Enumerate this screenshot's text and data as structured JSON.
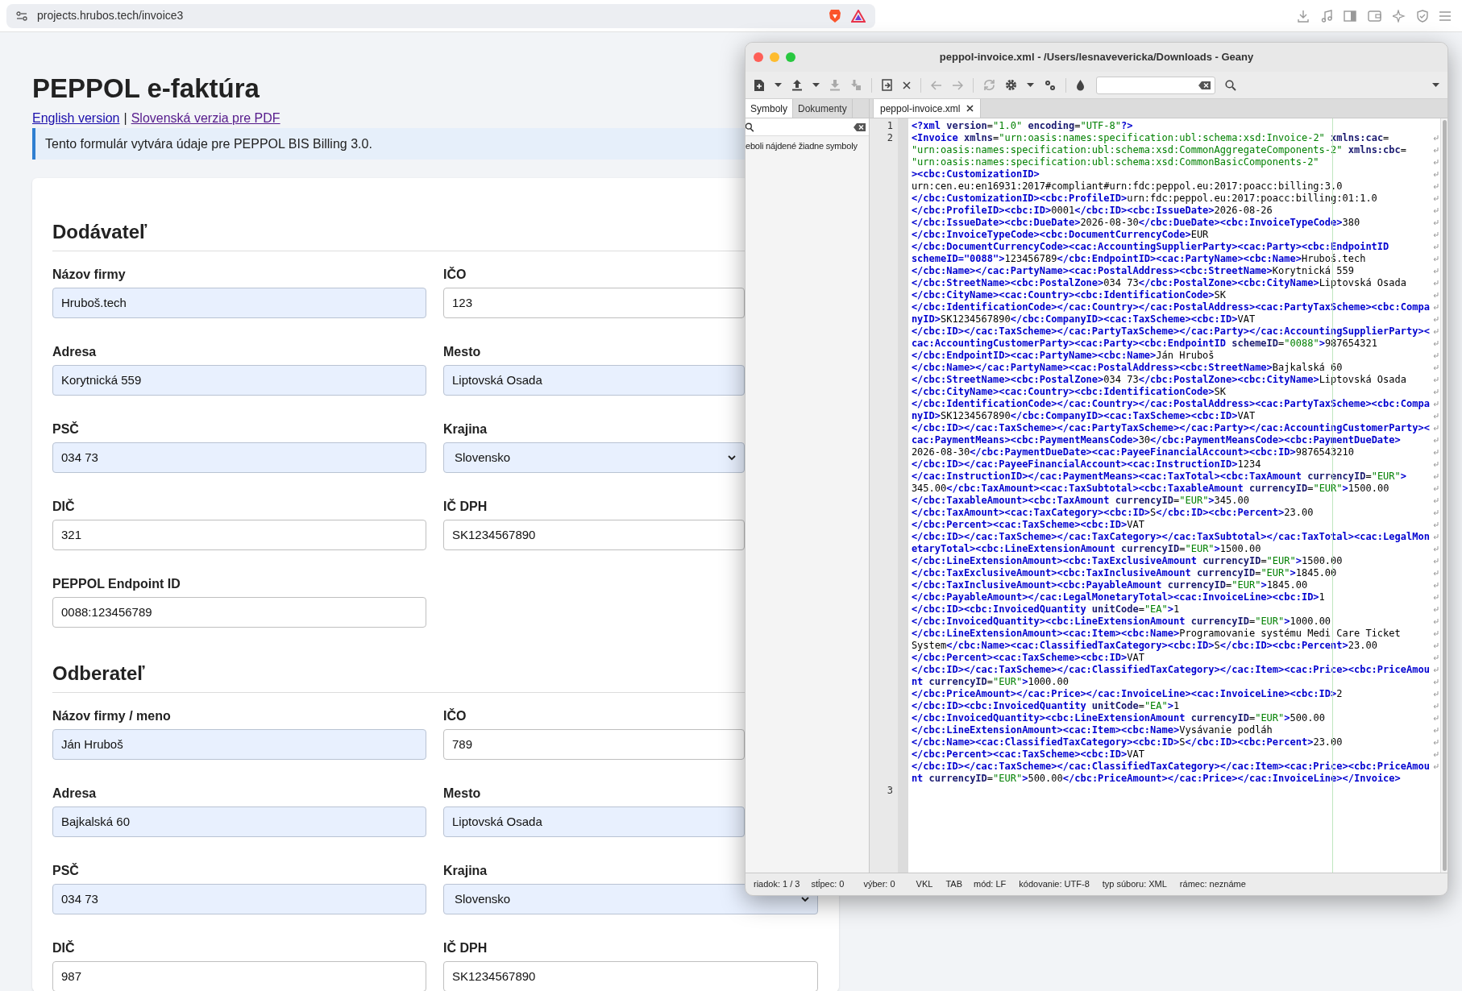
{
  "browser": {
    "url": "projects.hrubos.tech/invoice3"
  },
  "page": {
    "title": "PEPPOL e-faktúra",
    "links": [
      "English version",
      "Slovenská verzia pre PDF"
    ],
    "separator": "|",
    "info": "Tento formulár vytvára údaje pre PEPPOL BIS Billing 3.0.",
    "sections": [
      {
        "heading": "Dodávateľ",
        "fields": [
          {
            "label": "Názov firmy",
            "value": "Hruboš.tech",
            "kind": "input",
            "autofilled": true
          },
          {
            "label": "IČO",
            "value": "123",
            "kind": "input",
            "autofilled": false
          },
          {
            "label": "Adresa",
            "value": "Korytnická 559",
            "kind": "input",
            "autofilled": true
          },
          {
            "label": "Mesto",
            "value": "Liptovská Osada",
            "kind": "input",
            "autofilled": true
          },
          {
            "label": "PSČ",
            "value": "034 73",
            "kind": "input",
            "autofilled": true
          },
          {
            "label": "Krajina",
            "value": "Slovensko",
            "kind": "select",
            "autofilled": true
          },
          {
            "label": "DIČ",
            "value": "321",
            "kind": "input",
            "autofilled": false
          },
          {
            "label": "IČ DPH",
            "value": "SK1234567890",
            "kind": "input",
            "autofilled": false
          },
          {
            "label": "PEPPOL Endpoint ID",
            "value": "0088:123456789",
            "kind": "input",
            "autofilled": false
          }
        ]
      },
      {
        "heading": "Odberateľ",
        "fields": [
          {
            "label": "Názov firmy / meno",
            "value": "Ján Hruboš",
            "kind": "input",
            "autofilled": true
          },
          {
            "label": "IČO",
            "value": "789",
            "kind": "input",
            "autofilled": false
          },
          {
            "label": "Adresa",
            "value": "Bajkalská 60",
            "kind": "input",
            "autofilled": true
          },
          {
            "label": "Mesto",
            "value": "Liptovská Osada",
            "kind": "input",
            "autofilled": true
          },
          {
            "label": "PSČ",
            "value": "034 73",
            "kind": "input",
            "autofilled": true
          },
          {
            "label": "Krajina",
            "value": "Slovensko",
            "kind": "select",
            "autofilled": true
          },
          {
            "label": "DIČ",
            "value": "987",
            "kind": "input",
            "autofilled": false
          },
          {
            "label": "IČ DPH",
            "value": "SK1234567890",
            "kind": "input",
            "autofilled": false
          }
        ]
      }
    ]
  },
  "geany": {
    "title": "peppol-invoice.xml - /Users/lesnavevericka/Downloads - Geany",
    "sidebar_tabs": [
      {
        "label": "Symboly",
        "selected": true
      },
      {
        "label": "Dokumenty",
        "selected": false
      }
    ],
    "sidebar_message": "eboli nájdené žiadne symboly",
    "document_tab": "peppol-invoice.xml",
    "lines": [
      {
        "number": "1",
        "rows": [
          "<?xml version=\"1.0\" encoding=\"UTF-8\"?>"
        ]
      },
      {
        "number": "2",
        "rows": [
          "<Invoice xmlns=\"urn:oasis:names:specification:ubl:schema:xsd:Invoice-2\" xmlns:cac=",
          "\"urn:oasis:names:specification:ubl:schema:xsd:CommonAggregateComponents-2\" xmlns:cbc=",
          "\"urn:oasis:names:specification:ubl:schema:xsd:CommonBasicComponents-2\"",
          "><cbc:CustomizationID>",
          "urn:cen.eu:en16931:2017#compliant#urn:fdc:peppol.eu:2017:poacc:billing:3.0",
          "</cbc:CustomizationID><cbc:ProfileID>urn:fdc:peppol.eu:2017:poacc:billing:01:1.0",
          "</cbc:ProfileID><cbc:ID>0001</cbc:ID><cbc:IssueDate>2026-08-26",
          "</cbc:IssueDate><cbc:DueDate>2026-08-30</cbc:DueDate><cbc:InvoiceTypeCode>380",
          "</cbc:InvoiceTypeCode><cbc:DocumentCurrencyCode>EUR",
          "</cbc:DocumentCurrencyCode><cac:AccountingSupplierParty><cac:Party><cbc:EndpointID",
          "schemeID=\"0088\">123456789</cbc:EndpointID><cac:PartyName><cbc:Name>Hruboš.tech",
          "</cbc:Name></cac:PartyName><cac:PostalAddress><cbc:StreetName>Korytnická 559",
          "</cbc:StreetName><cbc:PostalZone>034 73</cbc:PostalZone><cbc:CityName>Liptovská Osada",
          "</cbc:CityName><cac:Country><cbc:IdentificationCode>SK",
          "</cbc:IdentificationCode></cac:Country></cac:PostalAddress><cac:PartyTaxScheme><cbc:Compa",
          "nyID>SK1234567890</cbc:CompanyID><cac:TaxScheme><cbc:ID>VAT",
          "</cbc:ID></cac:TaxScheme></cac:PartyTaxScheme></cac:Party></cac:AccountingSupplierParty><",
          "cac:AccountingCustomerParty><cac:Party><cbc:EndpointID schemeID=\"0088\">987654321",
          "</cbc:EndpointID><cac:PartyName><cbc:Name>Ján Hruboš",
          "</cbc:Name></cac:PartyName><cac:PostalAddress><cbc:StreetName>Bajkalská 60",
          "</cbc:StreetName><cbc:PostalZone>034 73</cbc:PostalZone><cbc:CityName>Liptovská Osada",
          "</cbc:CityName><cac:Country><cbc:IdentificationCode>SK",
          "</cbc:IdentificationCode></cac:Country></cac:PostalAddress><cac:PartyTaxScheme><cbc:Compa",
          "nyID>SK1234567890</cbc:CompanyID><cac:TaxScheme><cbc:ID>VAT",
          "</cbc:ID></cac:TaxScheme></cac:PartyTaxScheme></cac:Party></cac:AccountingCustomerParty><",
          "cac:PaymentMeans><cbc:PaymentMeansCode>30</cbc:PaymentMeansCode><cbc:PaymentDueDate>",
          "2026-08-30</cbc:PaymentDueDate><cac:PayeeFinancialAccount><cbc:ID>9876543210",
          "</cbc:ID></cac:PayeeFinancialAccount><cac:InstructionID>1234",
          "</cac:InstructionID></cac:PaymentMeans><cac:TaxTotal><cbc:TaxAmount currencyID=\"EUR\">",
          "345.00</cbc:TaxAmount><cac:TaxSubtotal><cbc:TaxableAmount currencyID=\"EUR\">1500.00",
          "</cbc:TaxableAmount><cbc:TaxAmount currencyID=\"EUR\">345.00",
          "</cbc:TaxAmount><cac:TaxCategory><cbc:ID>S</cbc:ID><cbc:Percent>23.00",
          "</cbc:Percent><cac:TaxScheme><cbc:ID>VAT",
          "</cbc:ID></cac:TaxScheme></cac:TaxCategory></cac:TaxSubtotal></cac:TaxTotal><cac:LegalMon",
          "etaryTotal><cbc:LineExtensionAmount currencyID=\"EUR\">1500.00",
          "</cbc:LineExtensionAmount><cbc:TaxExclusiveAmount currencyID=\"EUR\">1500.00",
          "</cbc:TaxExclusiveAmount><cbc:TaxInclusiveAmount currencyID=\"EUR\">1845.00",
          "</cbc:TaxInclusiveAmount><cbc:PayableAmount currencyID=\"EUR\">1845.00",
          "</cbc:PayableAmount></cac:LegalMonetaryTotal><cac:InvoiceLine><cbc:ID>1",
          "</cbc:ID><cbc:InvoicedQuantity unitCode=\"EA\">1",
          "</cbc:InvoicedQuantity><cbc:LineExtensionAmount currencyID=\"EUR\">1000.00",
          "</cbc:LineExtensionAmount><cac:Item><cbc:Name>Programovanie systému Medi Care Ticket",
          "System</cbc:Name><cac:ClassifiedTaxCategory><cbc:ID>S</cbc:ID><cbc:Percent>23.00",
          "</cbc:Percent><cac:TaxScheme><cbc:ID>VAT",
          "</cbc:ID></cac:TaxScheme></cac:ClassifiedTaxCategory></cac:Item><cac:Price><cbc:PriceAmou",
          "nt currencyID=\"EUR\">1000.00",
          "</cbc:PriceAmount></cac:Price></cac:InvoiceLine><cac:InvoiceLine><cbc:ID>2",
          "</cbc:ID><cbc:InvoicedQuantity unitCode=\"EA\">1",
          "</cbc:InvoicedQuantity><cbc:LineExtensionAmount currencyID=\"EUR\">500.00",
          "</cbc:LineExtensionAmount><cac:Item><cbc:Name>Vysávanie podláh",
          "</cbc:Name><cac:ClassifiedTaxCategory><cbc:ID>S</cbc:ID><cbc:Percent>23.00",
          "</cbc:Percent><cac:TaxScheme><cbc:ID>VAT",
          "</cbc:ID></cac:TaxScheme></cac:ClassifiedTaxCategory></cac:Item><cac:Price><cbc:PriceAmou",
          "nt currencyID=\"EUR\">500.00</cbc:PriceAmount></cac:Price></cac:InvoiceLine></Invoice>"
        ]
      },
      {
        "number": "3"
      }
    ],
    "status_bar": [
      "riadok: 1 / 3",
      "stĺpec: 0",
      "výber: 0",
      "VKL",
      "TAB",
      "mód: LF",
      "kódovanie: UTF-8",
      "typ súboru: XML",
      "rámec: neznáme"
    ]
  }
}
